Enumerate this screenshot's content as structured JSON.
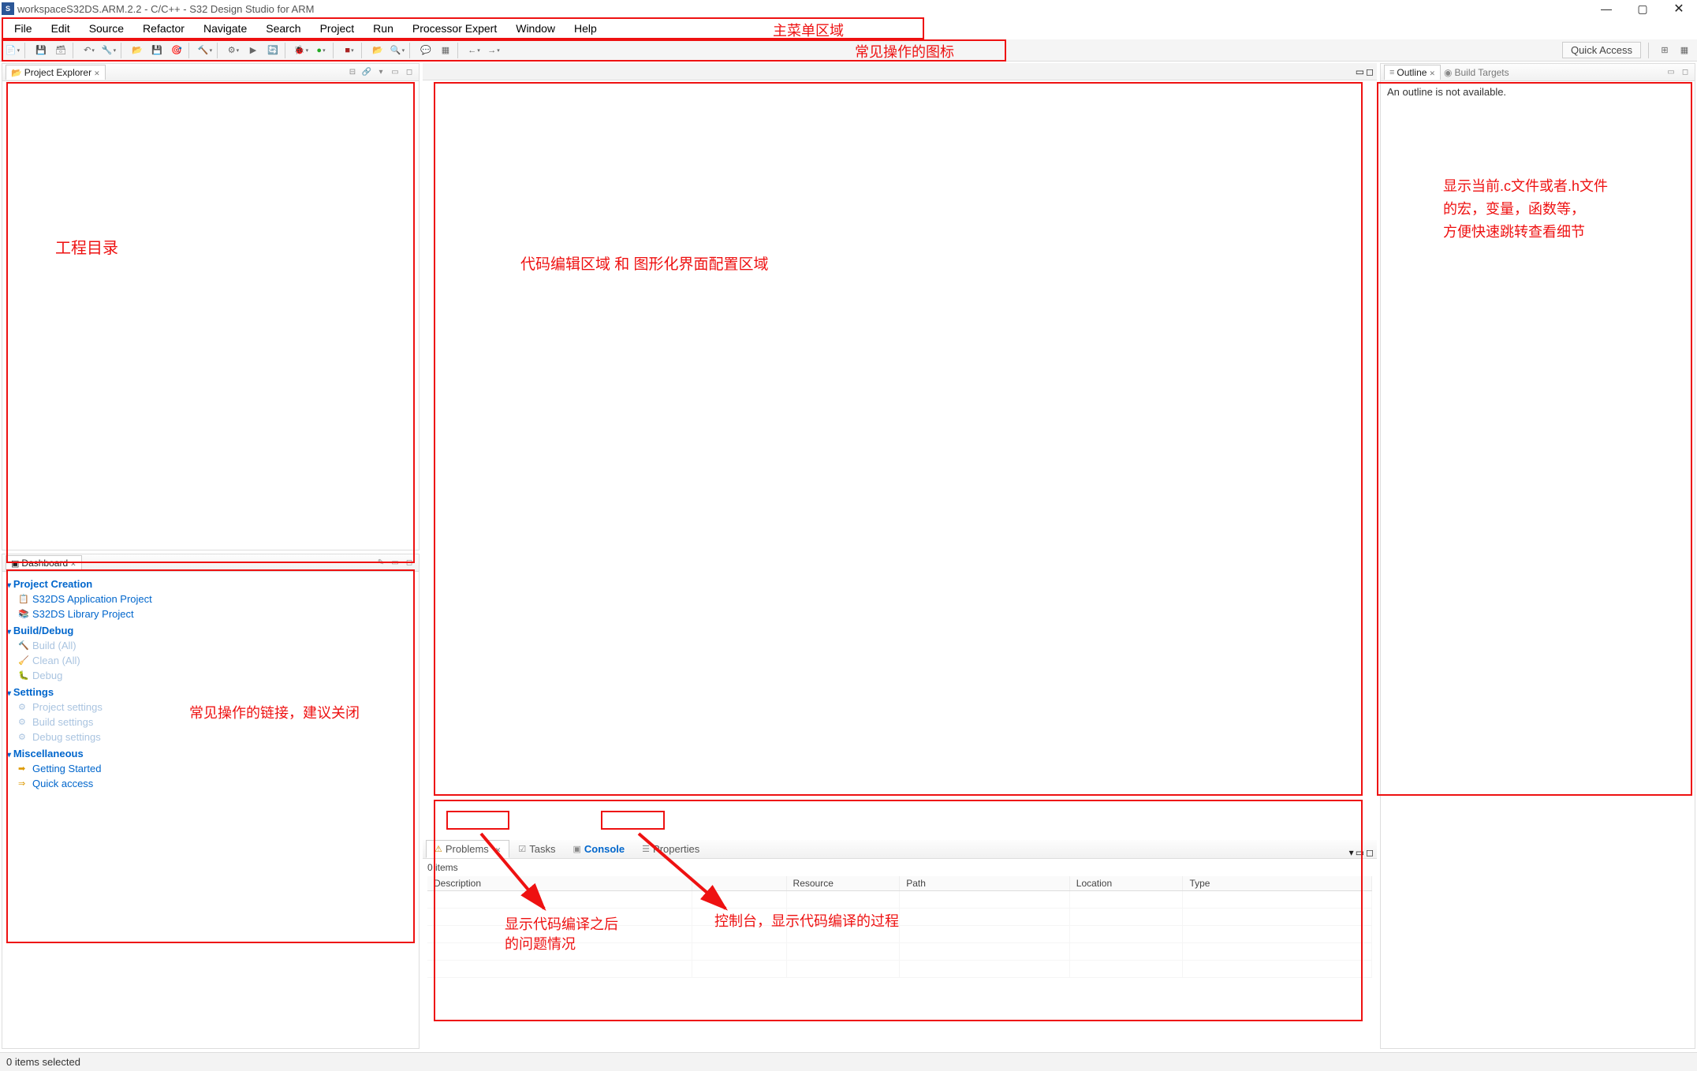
{
  "window": {
    "title": "workspaceS32DS.ARM.2.2 - C/C++ - S32 Design Studio for ARM"
  },
  "menu": {
    "items": [
      "File",
      "Edit",
      "Source",
      "Refactor",
      "Navigate",
      "Search",
      "Project",
      "Run",
      "Processor Expert",
      "Window",
      "Help"
    ]
  },
  "toolbar": {
    "quick_access": "Quick Access"
  },
  "annotations": {
    "menu": "主菜单区域",
    "toolbar": "常见操作的图标",
    "project_explorer": "工程目录",
    "editor": "代码编辑区域 和 图形化界面配置区域",
    "dashboard": "常见操作的链接，建议关闭",
    "problems": "显示代码编译之后\n的问题情况",
    "console": "控制台，显示代码编译的过程",
    "outline": "显示当前.c文件或者.h文件\n的宏，变量，函数等，\n方便快速跳转查看细节"
  },
  "project_explorer": {
    "tab_label": "Project Explorer"
  },
  "dashboard": {
    "tab_label": "Dashboard",
    "sections": {
      "project_creation": {
        "title": "Project Creation",
        "items": [
          "S32DS Application Project",
          "S32DS Library Project"
        ]
      },
      "build_debug": {
        "title": "Build/Debug",
        "items": [
          "Build  (All)",
          "Clean  (All)",
          "Debug"
        ]
      },
      "settings": {
        "title": "Settings",
        "items": [
          "Project settings",
          "Build settings",
          "Debug settings"
        ]
      },
      "misc": {
        "title": "Miscellaneous",
        "items": [
          "Getting Started",
          "Quick access"
        ]
      }
    }
  },
  "bottom_panel": {
    "tabs": [
      "Problems",
      "Tasks",
      "Console",
      "Properties"
    ],
    "status": "0 items",
    "columns": [
      "Description",
      "",
      "Resource",
      "Path",
      "Location",
      "Type"
    ]
  },
  "outline": {
    "tab_label": "Outline",
    "build_targets_label": "Build Targets",
    "body": "An outline is not available."
  },
  "status_bar": {
    "text": "0 items selected"
  }
}
